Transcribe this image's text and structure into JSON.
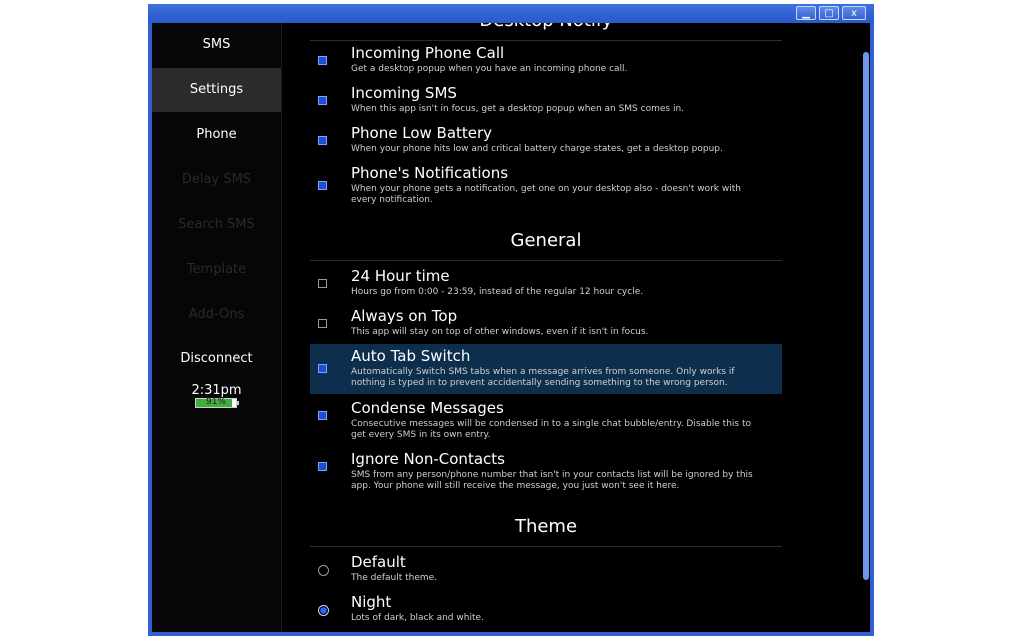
{
  "window": {
    "buttons": {
      "minimize": "▁",
      "maximize": "□",
      "close": "x"
    }
  },
  "sidebar": {
    "items": [
      {
        "label": "SMS",
        "state": "normal"
      },
      {
        "label": "Settings",
        "state": "active"
      },
      {
        "label": "Phone",
        "state": "normal"
      },
      {
        "label": "Delay SMS",
        "state": "disabled"
      },
      {
        "label": "Search SMS",
        "state": "disabled"
      },
      {
        "label": "Template",
        "state": "disabled"
      },
      {
        "label": "Add-Ons",
        "state": "disabled"
      },
      {
        "label": "Disconnect",
        "state": "normal"
      }
    ],
    "clock": "2:31pm",
    "battery": {
      "text": "91%",
      "level": 0.91,
      "color": "#3fae3f"
    }
  },
  "settings": {
    "desktop_notify_heading": "Desktop Notify",
    "desktop_notify": [
      {
        "title": "Incoming Phone Call",
        "desc": "Get a desktop popup when you have an incoming phone call.",
        "checked": true
      },
      {
        "title": "Incoming SMS",
        "desc": "When this app isn't in focus, get a desktop popup when an SMS comes in.",
        "checked": true
      },
      {
        "title": "Phone Low Battery",
        "desc": "When your phone hits low and critical battery charge states, get a desktop popup.",
        "checked": true
      },
      {
        "title": "Phone's Notifications",
        "desc": "When your phone gets a notification, get one on your desktop also - doesn't work with every notification.",
        "checked": true
      }
    ],
    "general_heading": "General",
    "general": [
      {
        "title": "24 Hour time",
        "desc": "Hours go from 0:00 - 23:59, instead of the regular 12 hour cycle.",
        "checked": false
      },
      {
        "title": "Always on Top",
        "desc": "This app will stay on top of other windows, even if it isn't in focus.",
        "checked": false
      },
      {
        "title": "Auto Tab Switch",
        "desc": "Automatically Switch SMS tabs when a message arrives from someone. Only works if nothing is typed in to prevent accidentally sending something to the wrong person.",
        "checked": true
      },
      {
        "title": "Condense Messages",
        "desc": "Consecutive messages will be condensed in to a single chat bubble/entry. Disable this to get every SMS in its own entry.",
        "checked": true
      },
      {
        "title": "Ignore Non-Contacts",
        "desc": "SMS from any person/phone number that isn't in your contacts list will be ignored by this app. Your phone will still receive the message, you just won't see it here.",
        "checked": true
      }
    ],
    "theme_heading": "Theme",
    "theme": [
      {
        "title": "Default",
        "desc": "The default theme.",
        "selected": false
      },
      {
        "title": "Night",
        "desc": "Lots of dark, black and white.",
        "selected": true
      }
    ]
  },
  "colors": {
    "accent": "#1a4fd6",
    "highlight_row": "#0d2f4d",
    "window_frame": "#2f5fd0"
  }
}
